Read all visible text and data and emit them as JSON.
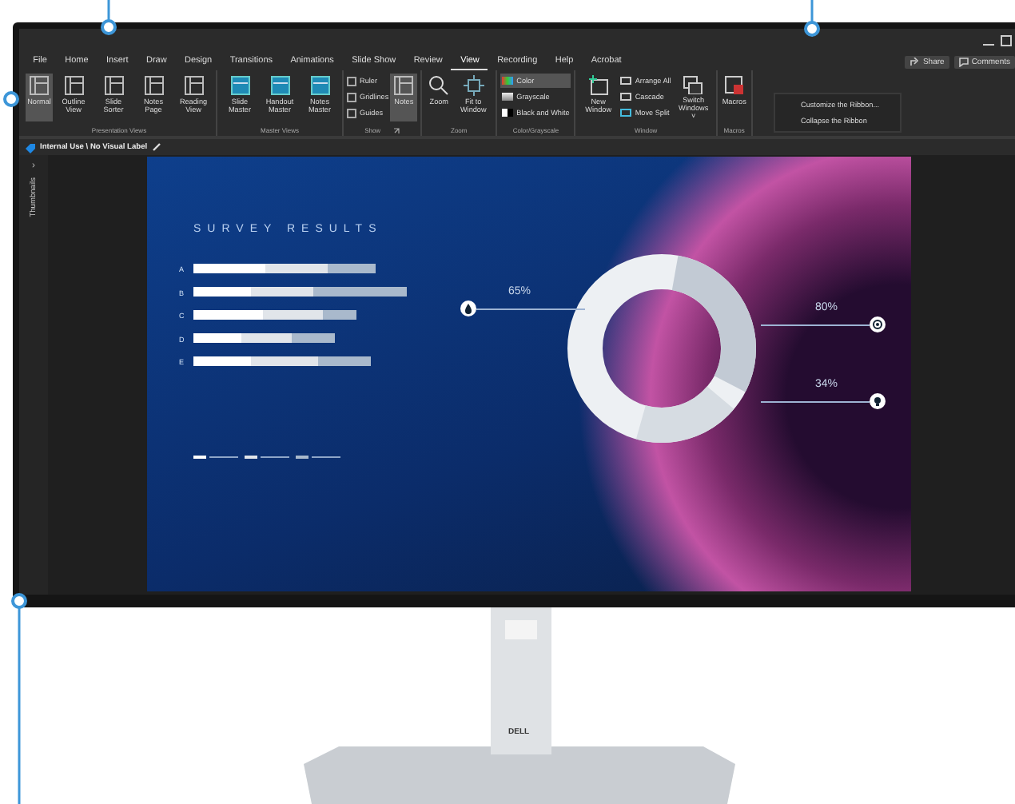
{
  "menu_tabs": [
    {
      "label": "File",
      "selected": false
    },
    {
      "label": "Home",
      "selected": false
    },
    {
      "label": "Insert",
      "selected": false
    },
    {
      "label": "Draw",
      "selected": false
    },
    {
      "label": "Design",
      "selected": false
    },
    {
      "label": "Transitions",
      "selected": false
    },
    {
      "label": "Animations",
      "selected": false
    },
    {
      "label": "Slide Show",
      "selected": false
    },
    {
      "label": "Review",
      "selected": false
    },
    {
      "label": "View",
      "selected": true
    },
    {
      "label": "Recording",
      "selected": false
    },
    {
      "label": "Help",
      "selected": false
    },
    {
      "label": "Acrobat",
      "selected": false
    }
  ],
  "header_buttons": [
    "Share",
    "Comments"
  ],
  "ribbon_groups": [
    {
      "name": "Presentation Views",
      "items": [
        {
          "kind": "big",
          "label": "Normal",
          "selected": true
        },
        {
          "kind": "big",
          "label": "Outline View",
          "selected": false
        },
        {
          "kind": "big",
          "label": "Slide Sorter",
          "selected": false
        },
        {
          "kind": "big",
          "label": "Notes Page",
          "selected": false
        },
        {
          "kind": "big",
          "label": "Reading View",
          "selected": false
        }
      ]
    },
    {
      "name": "Master Views",
      "items": [
        {
          "kind": "big",
          "label": "Slide Master",
          "selected": false
        },
        {
          "kind": "big",
          "label": "Handout Master",
          "selected": false
        },
        {
          "kind": "big",
          "label": "Notes Master",
          "selected": false
        }
      ]
    },
    {
      "name": "Show",
      "launcher": true,
      "items": [
        {
          "kind": "check",
          "label": "Ruler",
          "checked": false
        },
        {
          "kind": "check",
          "label": "Gridlines",
          "checked": false
        },
        {
          "kind": "check",
          "label": "Guides",
          "checked": false
        },
        {
          "kind": "big",
          "label": "Notes",
          "selected": true
        }
      ]
    },
    {
      "name": "Zoom",
      "items": [
        {
          "kind": "big",
          "label": "Zoom",
          "selected": false
        },
        {
          "kind": "big",
          "label": "Fit to Window",
          "selected": false
        }
      ]
    },
    {
      "name": "Color/Grayscale",
      "items": [
        {
          "kind": "small",
          "label": "Color",
          "selected": true
        },
        {
          "kind": "small",
          "label": "Grayscale",
          "selected": false
        },
        {
          "kind": "small",
          "label": "Black and White",
          "selected": false
        }
      ]
    },
    {
      "name": "Window",
      "items": [
        {
          "kind": "big",
          "label": "New Window",
          "selected": false
        },
        {
          "kind": "small",
          "label": "Arrange All",
          "selected": false
        },
        {
          "kind": "small",
          "label": "Cascade",
          "selected": false
        },
        {
          "kind": "small",
          "label": "Move Split",
          "selected": false
        },
        {
          "kind": "big",
          "label": "Switch Windows ˅",
          "selected": false
        }
      ]
    },
    {
      "name": "Macros",
      "items": [
        {
          "kind": "big",
          "label": "Macros",
          "selected": false
        }
      ]
    }
  ],
  "context_menu": [
    "Customize the Ribbon...",
    "Collapse the Ribbon"
  ],
  "sensitivity_label": "Internal Use \\ No Visual Label",
  "thumbnails_toggle": "›",
  "thumbnails_label": "Thumbnails",
  "slide": {
    "title": "SURVEY RESULTS",
    "categories": [
      "A",
      "B",
      "C",
      "D",
      "E"
    ],
    "callouts": [
      "65%",
      "80%",
      "34%"
    ]
  },
  "logo": "DELL"
}
